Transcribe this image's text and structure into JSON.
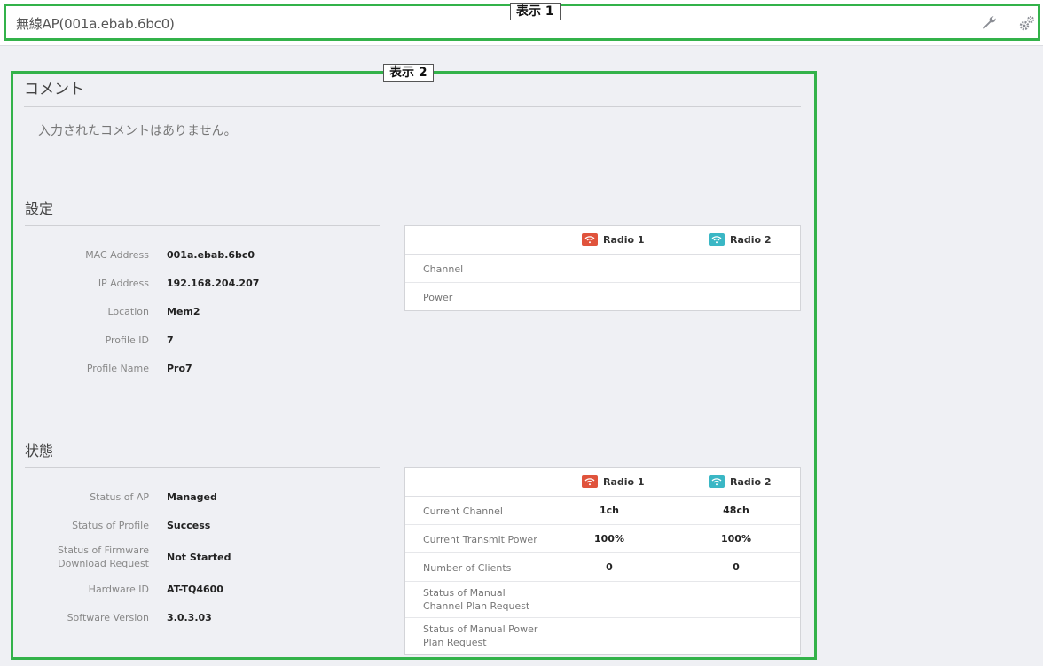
{
  "header": {
    "title": "無線AP(001a.ebab.6bc0)",
    "icons": [
      "wrench-icon",
      "gears-icon"
    ]
  },
  "callouts": {
    "one": "表示 1",
    "two": "表示 2"
  },
  "comment": {
    "heading": "コメント",
    "text": "入力されたコメントはありません。"
  },
  "settings": {
    "heading": "設定",
    "rows": [
      {
        "label": "MAC Address",
        "value": "001a.ebab.6bc0"
      },
      {
        "label": "IP Address",
        "value": "192.168.204.207"
      },
      {
        "label": "Location",
        "value": "Mem2"
      },
      {
        "label": "Profile ID",
        "value": "7"
      },
      {
        "label": "Profile Name",
        "value": "Pro7"
      }
    ],
    "radio_table": {
      "radios": [
        {
          "label": "Radio 1",
          "color": "#e0533c"
        },
        {
          "label": "Radio 2",
          "color": "#3ab7c5"
        }
      ],
      "rows": [
        {
          "label": "Channel",
          "values": [
            "",
            ""
          ]
        },
        {
          "label": "Power",
          "values": [
            "",
            ""
          ]
        }
      ]
    }
  },
  "status": {
    "heading": "状態",
    "rows": [
      {
        "label": "Status of AP",
        "value": "Managed"
      },
      {
        "label": "Status of Profile",
        "value": "Success"
      },
      {
        "label": "Status of Firmware\nDownload Request",
        "value": "Not Started"
      },
      {
        "label": "Hardware ID",
        "value": "AT-TQ4600"
      },
      {
        "label": "Software Version",
        "value": "3.0.3.03"
      }
    ],
    "radio_table": {
      "radios": [
        {
          "label": "Radio 1",
          "color": "#e0533c"
        },
        {
          "label": "Radio 2",
          "color": "#3ab7c5"
        }
      ],
      "rows": [
        {
          "label": "Current Channel",
          "values": [
            "1ch",
            "48ch"
          ]
        },
        {
          "label": "Current Transmit Power",
          "values": [
            "100%",
            "100%"
          ]
        },
        {
          "label": "Number of Clients",
          "values": [
            "0",
            "0"
          ]
        },
        {
          "label": "Status of Manual\nChannel Plan Request",
          "values": [
            "",
            ""
          ]
        },
        {
          "label": "Status of Manual Power\nPlan Request",
          "values": [
            "",
            ""
          ]
        }
      ]
    }
  },
  "colors": {
    "frame": "#33b24a",
    "background": "#eff0f4"
  }
}
